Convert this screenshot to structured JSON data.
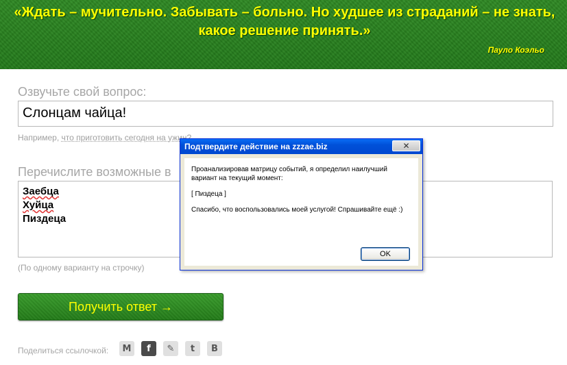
{
  "banner": {
    "quote": "«Ждать – мучительно. Забывать – больно. Но худшее из страданий – не знать, какое решение принять.»",
    "author": "Пауло Коэльо"
  },
  "question": {
    "label": "Озвучьте свой вопрос:",
    "value": "Слонцам чайца!",
    "hint_prefix": "Например,",
    "hint_link": "что приготовить сегодня на ужин?"
  },
  "variants": {
    "label": "Перечислите возможные в",
    "items": [
      "Заебца",
      "Хуйца",
      "Пиздеца"
    ],
    "hint": "(По одному варианту на строчку)"
  },
  "submit_label": "Получить ответ →",
  "share": {
    "label": "Поделиться ссылочкой:",
    "icons": [
      "gmail-icon",
      "facebook-icon",
      "livejournal-icon",
      "twitter-icon",
      "vkontakte-icon"
    ],
    "icon_glyphs": [
      "M",
      "f",
      "✎",
      "t",
      "B"
    ]
  },
  "dialog": {
    "title": "Подтвердите действие на zzzae.biz",
    "close": "✕",
    "line1": "Проанализировав матрицу событий, я определил наилучший вариант на текущий момент:",
    "answer": "[   Пиздеца   ]",
    "line2": "Спасибо, что воспользовались моей услугой! Спрашивайте ещё :)",
    "ok_label": "OK"
  },
  "colors": {
    "banner_green": "#2a8520",
    "quote_yellow": "#ffff00",
    "dialog_title_blue": "#0050d8"
  }
}
